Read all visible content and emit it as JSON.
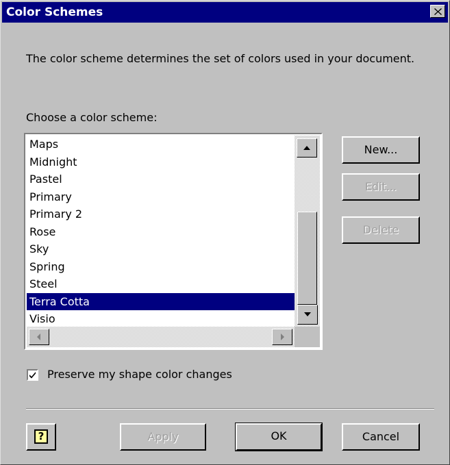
{
  "window": {
    "title": "Color Schemes",
    "close_icon": "close-icon"
  },
  "description": "The color scheme determines the set of colors used in your document.",
  "list_label": "Choose a color scheme:",
  "schemes": [
    {
      "label": "Maps",
      "selected": false
    },
    {
      "label": "Midnight",
      "selected": false
    },
    {
      "label": "Pastel",
      "selected": false
    },
    {
      "label": "Primary",
      "selected": false
    },
    {
      "label": "Primary 2",
      "selected": false
    },
    {
      "label": "Rose",
      "selected": false
    },
    {
      "label": "Sky",
      "selected": false
    },
    {
      "label": "Spring",
      "selected": false
    },
    {
      "label": "Steel",
      "selected": false
    },
    {
      "label": "Terra Cotta",
      "selected": true
    },
    {
      "label": "Visio",
      "selected": false
    }
  ],
  "side_buttons": {
    "new": "New...",
    "edit": "Edit...",
    "delete": "Delete"
  },
  "preserve_checkbox": {
    "label": "Preserve my shape color changes",
    "checked": true
  },
  "footer": {
    "help_icon": "help-icon",
    "help_glyph": "?",
    "apply": "Apply",
    "ok": "OK",
    "cancel": "Cancel"
  },
  "colors": {
    "titlebar": "#000080",
    "face": "#c0c0c0",
    "selection": "#000080"
  }
}
